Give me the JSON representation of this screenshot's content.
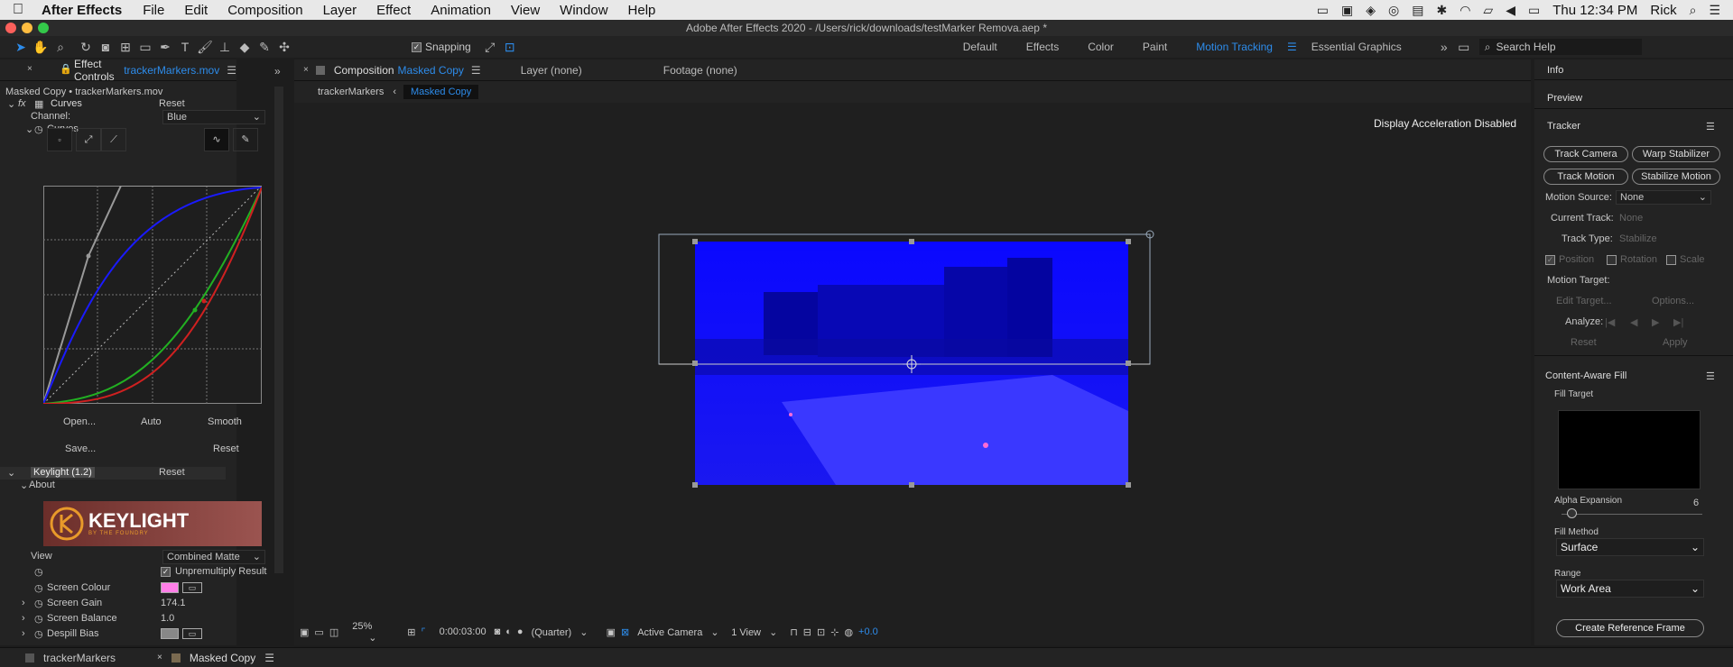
{
  "menubar": {
    "app": "After Effects",
    "items": [
      "File",
      "Edit",
      "Composition",
      "Layer",
      "Effect",
      "Animation",
      "View",
      "Window",
      "Help"
    ],
    "time": "Thu 12:34 PM",
    "user": "Rick"
  },
  "window": {
    "title": "Adobe After Effects 2020 - /Users/rick/downloads/testMarker Remova.aep *"
  },
  "toolbar": {
    "snapping": "Snapping",
    "workspaces": [
      "Default",
      "Effects",
      "Color",
      "Paint",
      "Motion Tracking",
      "Essential Graphics"
    ],
    "search": "Search Help"
  },
  "effect_controls": {
    "tab_label": "Effect Controls",
    "tab_file": "trackerMarkers.mov",
    "layer_path": "Masked Copy • trackerMarkers.mov",
    "curves": {
      "name": "Curves",
      "reset": "Reset",
      "channel_label": "Channel:",
      "channel_value": "Blue",
      "prop": "Curves",
      "buttons": [
        "Open...",
        "Auto",
        "Smooth",
        "Save...",
        "Reset"
      ]
    },
    "keylight": {
      "name": "Keylight (1.2)",
      "reset": "Reset",
      "about": "About",
      "logo": "KEYLIGHT",
      "logo_sub": "BY THE FOUNDRY",
      "view_label": "View",
      "view_value": "Combined Matte",
      "unpremultiply": "Unpremultiply Result",
      "screen_colour": "Screen Colour",
      "screen_gain": "Screen Gain",
      "screen_gain_val": "174.1",
      "screen_balance": "Screen Balance",
      "screen_balance_val": "1.0",
      "despill": "Despill Bias"
    }
  },
  "composition": {
    "tab_label": "Composition",
    "tab_name": "Masked Copy",
    "layer_tab": "Layer (none)",
    "footage_tab": "Footage (none)",
    "crumb1": "trackerMarkers",
    "crumb2": "Masked Copy",
    "notice": "Display Acceleration Disabled"
  },
  "viewer_bar": {
    "zoom": "25%",
    "timecode": "0:00:03:00",
    "resolution": "(Quarter)",
    "camera": "Active Camera",
    "views": "1 View",
    "exposure": "+0.0"
  },
  "right": {
    "info": "Info",
    "preview": "Preview",
    "tracker": "Tracker",
    "buttons": [
      "Track Camera",
      "Warp Stabilizer",
      "Track Motion",
      "Stabilize Motion"
    ],
    "motion_source_label": "Motion Source:",
    "motion_source": "None",
    "current_track_label": "Current Track:",
    "current_track": "None",
    "track_type_label": "Track Type:",
    "track_type": "Stabilize",
    "position": "Position",
    "rotation": "Rotation",
    "scale": "Scale",
    "motion_target": "Motion Target:",
    "edit_target": "Edit Target...",
    "options": "Options...",
    "analyze": "Analyze:",
    "reset": "Reset",
    "apply": "Apply",
    "caf": "Content-Aware Fill",
    "fill_target": "Fill Target",
    "alpha_expansion": "Alpha Expansion",
    "alpha_value": "6",
    "fill_method": "Fill Method",
    "fill_method_value": "Surface",
    "range": "Range",
    "range_value": "Work Area",
    "create_ref": "Create Reference Frame"
  },
  "bottom_tabs": [
    "trackerMarkers",
    "Masked Copy"
  ]
}
